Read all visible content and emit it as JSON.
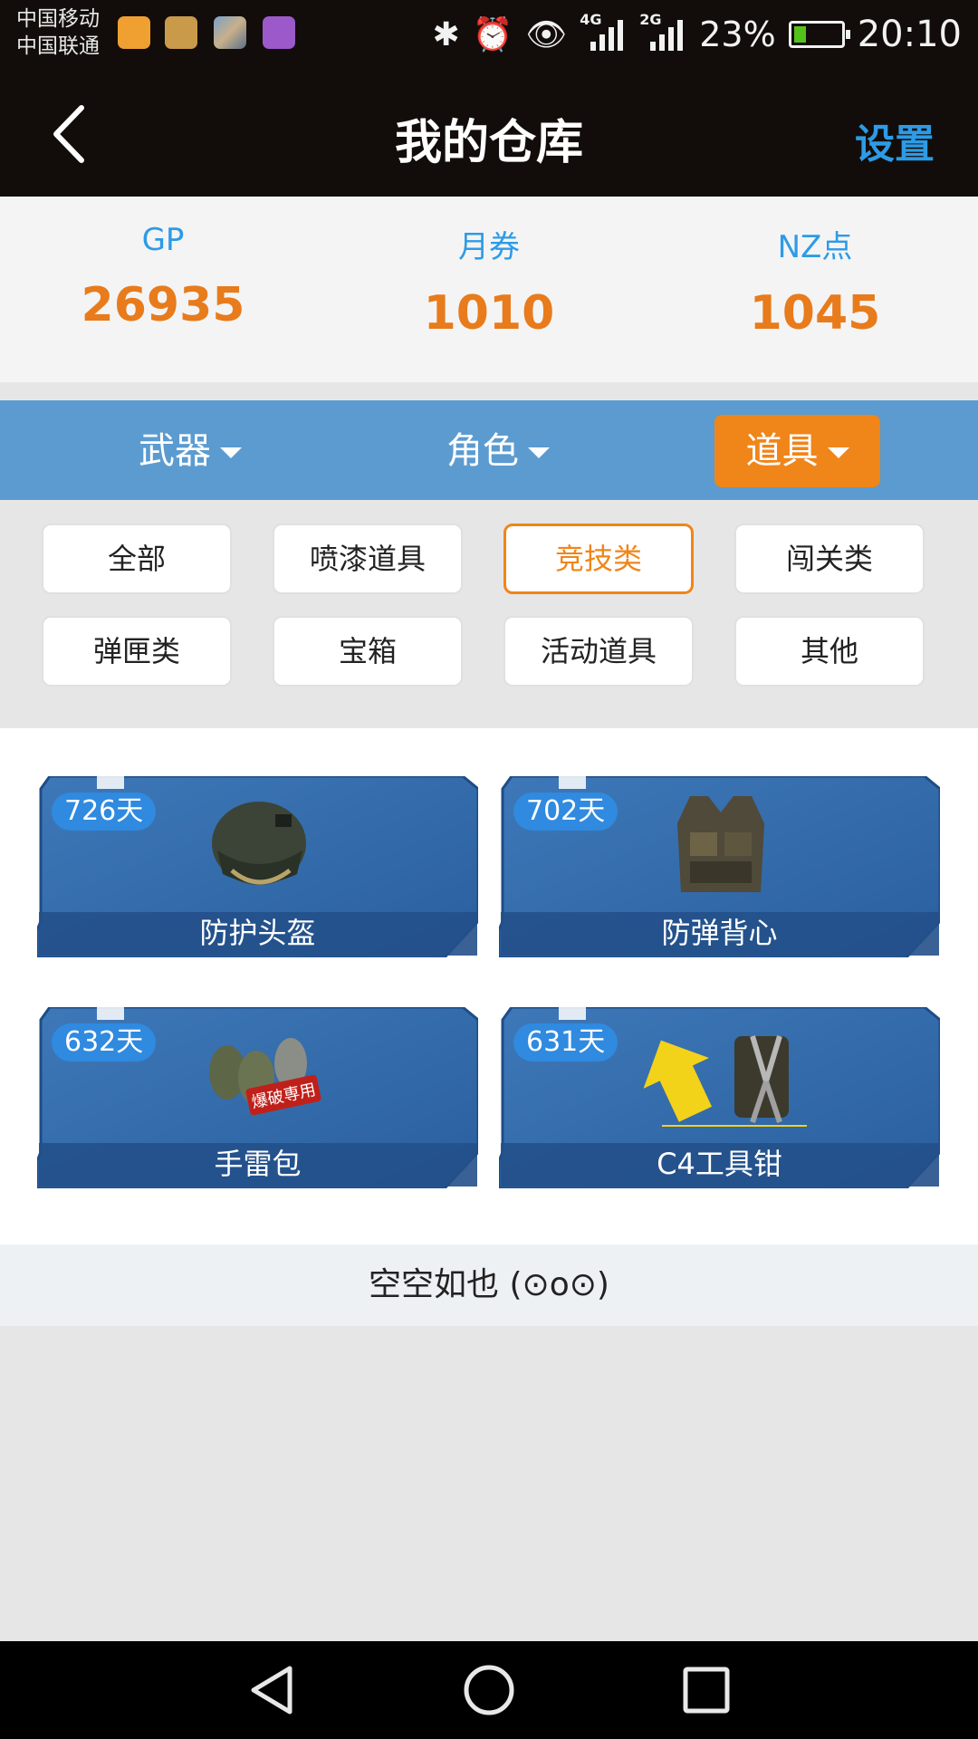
{
  "status_bar": {
    "carrier_1": "中国移动",
    "carrier_2": "中国联通",
    "net_1": "4G",
    "net_2": "2G",
    "battery": "23%",
    "battery_level": 0.23,
    "time": "20:10",
    "app_icons": [
      "uc-browser-icon",
      "qq-icon",
      "gallery-thumb-icon",
      "photo-app-icon"
    ]
  },
  "header": {
    "title": "我的仓库",
    "settings_label": "设置"
  },
  "balances": [
    {
      "label": "GP",
      "value": "26935"
    },
    {
      "label": "月券",
      "value": "1010"
    },
    {
      "label": "NZ点",
      "value": "1045"
    }
  ],
  "categories": [
    {
      "label": "武器",
      "active": false
    },
    {
      "label": "角色",
      "active": false
    },
    {
      "label": "道具",
      "active": true
    }
  ],
  "filters": [
    {
      "label": "全部",
      "active": false
    },
    {
      "label": "喷漆道具",
      "active": false
    },
    {
      "label": "竞技类",
      "active": true
    },
    {
      "label": "闯关类",
      "active": false
    },
    {
      "label": "弹匣类",
      "active": false
    },
    {
      "label": "宝箱",
      "active": false
    },
    {
      "label": "活动道具",
      "active": false
    },
    {
      "label": "其他",
      "active": false
    }
  ],
  "items": [
    {
      "days": "726天",
      "name": "防护头盔",
      "icon": "helmet-icon"
    },
    {
      "days": "702天",
      "name": "防弹背心",
      "icon": "vest-icon"
    },
    {
      "days": "632天",
      "name": "手雷包",
      "icon": "grenade-pack-icon",
      "stamp": "爆破専用"
    },
    {
      "days": "631天",
      "name": "C4工具钳",
      "icon": "c4-pliers-icon"
    }
  ],
  "empty_note": "空空如也 (⊙o⊙)",
  "colors": {
    "accent_orange": "#f08519",
    "accent_blue": "#2d9be6",
    "category_bar": "#5b9bd0",
    "header_bg": "#120d0a"
  }
}
